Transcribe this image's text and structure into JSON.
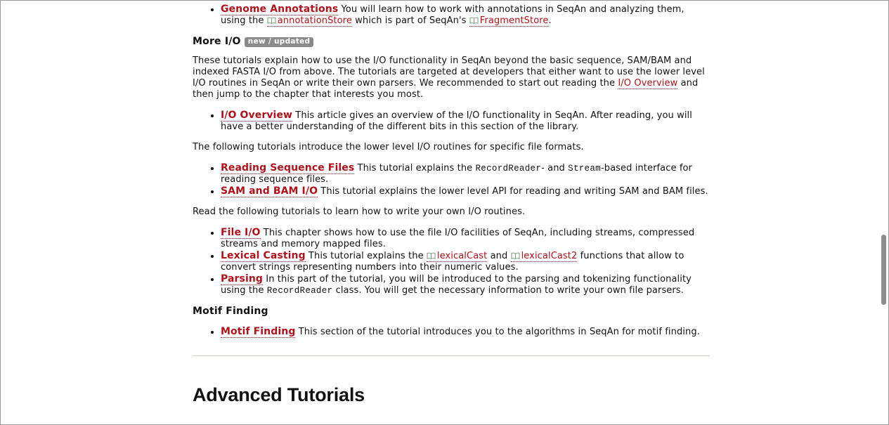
{
  "section_top": {
    "item": {
      "title": "Genome Annotations",
      "text_before": " You will learn how to work with annotations in SeqAn and analyzing them, using the ",
      "ref1": "annotationStore",
      "text_mid": " which is part of SeqAn's ",
      "ref2": "FragmentStore",
      "text_after": "."
    }
  },
  "more_io": {
    "heading": "More I/O",
    "badge": "new / updated",
    "intro_before": "These tutorials explain how to use the I/O functionality in SeqAn beyond the basic sequence, SAM/BAM and indexed FASTA I/O from above. The tutorials are targeted at developers that either want to use the lower level I/O routines in SeqAn or write their own parsers. We recommended to start out reading the ",
    "intro_link": "I/O Overview",
    "intro_after": " and then jump to the chapter that interests you most.",
    "overview_item": {
      "title": "I/O Overview",
      "text": " This article gives an overview of the I/O functionality in SeqAn. After reading, you will have a better understanding of the different bits in this section of the library."
    },
    "lower_level_intro": "The following tutorials introduce the lower level I/O routines for specific file formats.",
    "reading_seq": {
      "title": "Reading Sequence Files",
      "text1": " This tutorial explains the ",
      "code1": "RecordReader",
      "text2": "- and ",
      "code2": "Stream",
      "text3": "-based interface for reading sequence files."
    },
    "sam_bam": {
      "title": "SAM and BAM I/O",
      "text": " This tutorial explains the lower level API for reading and writing SAM and BAM files."
    },
    "own_routines_intro": "Read the following tutorials to learn how to write your own I/O routines.",
    "file_io": {
      "title": "File I/O",
      "text": " This chapter shows how to use the file I/O facilities of SeqAn, including streams, compressed streams and memory mapped files."
    },
    "lexical": {
      "title": "Lexical Casting",
      "text1": " This tutorial explains the ",
      "ref1": "lexicalCast",
      "text2": " and ",
      "ref2": "lexicalCast2",
      "text3": " functions that allow to convert strings representing numbers into their numeric values."
    },
    "parsing": {
      "title": "Parsing",
      "text1": " In this part of the tutorial, you will be introduced to the parsing and tokenizing functionality using the ",
      "code1": "RecordReader",
      "text2": " class. You will get the necessary information to write your own file parsers."
    }
  },
  "motif": {
    "heading": "Motif Finding",
    "item": {
      "title": "Motif Finding",
      "text": " This section of the tutorial introduces you to the algorithms in SeqAn for motif finding."
    }
  },
  "advanced": {
    "heading": "Advanced Tutorials"
  },
  "colors": {
    "link": "#b0121b",
    "badge_bg": "#8a8a8a",
    "divider": "#cfcfc4",
    "scroll_thumb": "#8d8d8d"
  },
  "icons": {
    "doc_ref": "book-icon"
  }
}
